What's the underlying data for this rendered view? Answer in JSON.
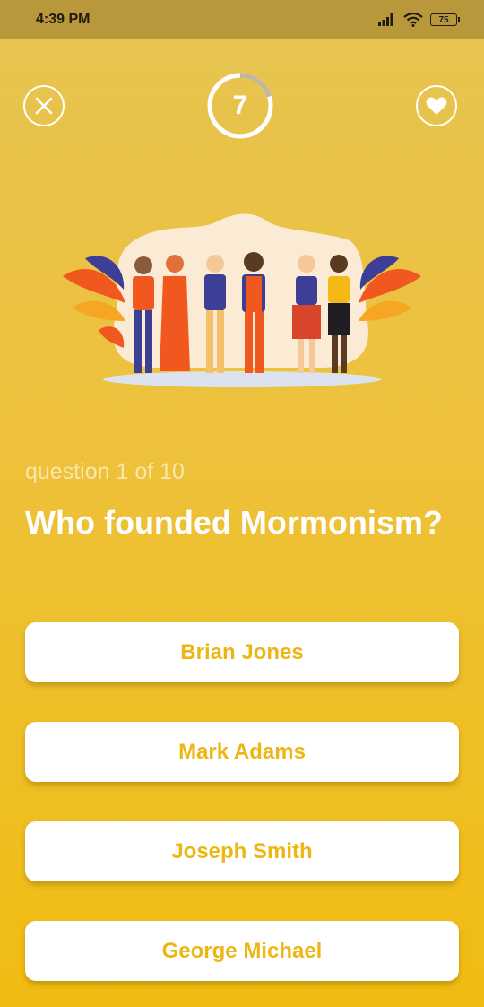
{
  "status_bar": {
    "time": "4:39 PM",
    "battery": "75"
  },
  "header": {
    "timer_value": "7",
    "timer_progress": 0.2
  },
  "quiz": {
    "counter": "question 1 of 10",
    "question": "Who founded Mormonism?",
    "answers": [
      "Brian Jones",
      "Mark Adams",
      "Joseph Smith",
      "George Michael"
    ]
  },
  "colors": {
    "accent": "#ecb714",
    "background_top": "#e6c452",
    "background_bottom": "#f0bc12"
  },
  "icons": {
    "close": "close-icon",
    "favorite": "heart-icon"
  }
}
